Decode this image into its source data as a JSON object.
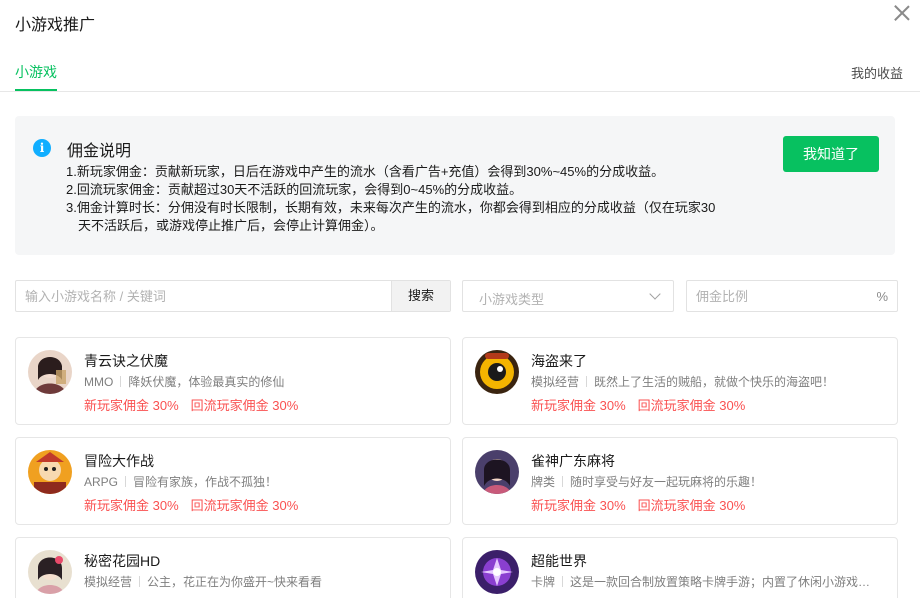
{
  "dialog": {
    "title": "小游戏推广"
  },
  "tabs": {
    "active_label": "小游戏",
    "earnings_label": "我的收益"
  },
  "notice": {
    "title": "佣金说明",
    "lines": [
      "1.新玩家佣金：贡献新玩家，日后在游戏中产生的流水（含看广告+充值）会得到30%~45%的分成收益。",
      "2.回流玩家佣金：贡献超过30天不活跃的回流玩家，会得到0~45%的分成收益。",
      "3.佣金计算时长：分佣没有时长限制，长期有效，未来每次产生的流水，你都会得到相应的分成收益（仅在玩家30",
      "天不活跃后，或游戏停止推广后，会停止计算佣金）。"
    ],
    "ack_button": "我知道了"
  },
  "filters": {
    "search_placeholder": "输入小游戏名称 / 关键词",
    "search_button": "搜索",
    "type_placeholder": "小游戏类型",
    "ratio_placeholder": "佣金比例",
    "ratio_suffix": "%"
  },
  "games": [
    {
      "name": "青云诀之伏魔",
      "category": "MMO",
      "description": "降妖伏魔，体验最真实的修仙",
      "new_player_commission": "新玩家佣金 30%",
      "returning_player_commission": "回流玩家佣金 30%",
      "avatar_icon": "game-avatar-icon"
    },
    {
      "name": "海盗来了",
      "category": "模拟经营",
      "description": "既然上了生活的贼船，就做个快乐的海盗吧！",
      "new_player_commission": "新玩家佣金 30%",
      "returning_player_commission": "回流玩家佣金 30%",
      "avatar_icon": "game-avatar-icon"
    },
    {
      "name": "冒险大作战",
      "category": "ARPG",
      "description": "冒险有家族，作战不孤独！",
      "new_player_commission": "新玩家佣金 30%",
      "returning_player_commission": "回流玩家佣金 30%",
      "avatar_icon": "game-avatar-icon"
    },
    {
      "name": "雀神广东麻将",
      "category": "牌类",
      "description": "随时享受与好友一起玩麻将的乐趣！",
      "new_player_commission": "新玩家佣金 30%",
      "returning_player_commission": "回流玩家佣金 30%",
      "avatar_icon": "game-avatar-icon"
    },
    {
      "name": "秘密花园HD",
      "category": "模拟经营",
      "description": "公主，花正在为你盛开~快来看看",
      "new_player_commission": "",
      "returning_player_commission": "",
      "avatar_icon": "game-avatar-icon"
    },
    {
      "name": "超能世界",
      "category": "卡牌",
      "description": "这是一款回合制放置策略卡牌手游；内置了休闲小游戏玩法",
      "new_player_commission": "",
      "returning_player_commission": "",
      "avatar_icon": "game-avatar-icon"
    }
  ],
  "colors": {
    "accent": "#07c160",
    "commission": "#fa5151",
    "info": "#10aeff"
  }
}
